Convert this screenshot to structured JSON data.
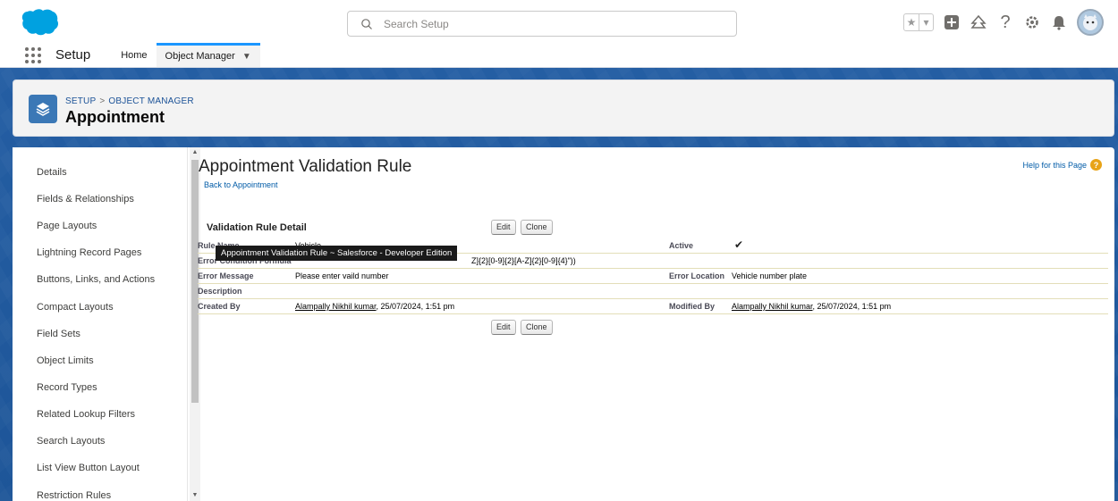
{
  "header": {
    "search_placeholder": "Search Setup",
    "icons": [
      "star-icon",
      "chevron-down-icon",
      "plus-icon",
      "trailhead-icon",
      "help-icon",
      "gear-icon",
      "bell-icon",
      "avatar"
    ]
  },
  "nav": {
    "app_name": "Setup",
    "tabs": [
      {
        "label": "Home",
        "active": false
      },
      {
        "label": "Object Manager",
        "active": true
      }
    ]
  },
  "page_header": {
    "breadcrumb": [
      "SETUP",
      "OBJECT MANAGER"
    ],
    "breadcrumb_sep": ">",
    "title": "Appointment"
  },
  "sidebar": {
    "items": [
      "Details",
      "Fields & Relationships",
      "Page Layouts",
      "Lightning Record Pages",
      "Buttons, Links, and Actions",
      "Compact Layouts",
      "Field Sets",
      "Object Limits",
      "Record Types",
      "Related Lookup Filters",
      "Search Layouts",
      "List View Button Layout",
      "Restriction Rules"
    ]
  },
  "content": {
    "title": "Appointment Validation Rule",
    "back_link": "Back to Appointment",
    "help_link": "Help for this Page",
    "section_title": "Validation Rule Detail",
    "buttons": {
      "edit": "Edit",
      "clone": "Clone"
    },
    "tooltip": "Appointment Validation Rule ~ Salesforce - Developer Edition",
    "fields": {
      "rule_name_label": "Rule Name",
      "rule_name_value": "Vehicle",
      "active_label": "Active",
      "error_formula_label": "Error Condition Formula",
      "error_formula_value": "Z]{2}[0-9]{2}[A-Z]{2}[0-9]{4}\"))",
      "error_message_label": "Error Message",
      "error_message_value": "Please enter vaild number",
      "error_location_label": "Error Location",
      "error_location_value": "Vehicle number plate",
      "description_label": "Description",
      "created_by_label": "Created By",
      "created_by_name": "Alampally Nikhil kumar",
      "created_by_date": ", 25/07/2024, 1:51 pm",
      "modified_by_label": "Modified By",
      "modified_by_name": "Alampally Nikhil kumar",
      "modified_by_date": ", 25/07/2024, 1:51 pm"
    }
  },
  "colors": {
    "accent": "#1b96ff",
    "band": "#1d4f91",
    "object_icon": "#3b78b6",
    "link": "#015ba7"
  }
}
